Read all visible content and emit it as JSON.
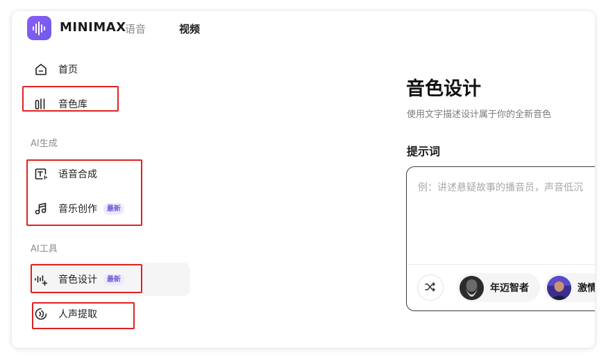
{
  "header": {
    "brand": "MINIMAX",
    "nav": [
      {
        "label": "语音"
      },
      {
        "label": "视频"
      }
    ]
  },
  "sidebar": {
    "items_top": [
      {
        "label": "首页",
        "icon": "home-icon"
      },
      {
        "label": "音色库",
        "icon": "library-icon"
      }
    ],
    "section_ai_generate": "AI生成",
    "items_generate": [
      {
        "label": "语音合成",
        "icon": "text-to-speech-icon"
      },
      {
        "label": "音乐创作",
        "icon": "music-note-icon",
        "badge": "最新"
      }
    ],
    "section_ai_tools": "AI工具",
    "items_tools": [
      {
        "label": "音色设计",
        "icon": "voice-design-icon",
        "badge": "最新",
        "active": true
      },
      {
        "label": "人声提取",
        "icon": "voice-extract-icon"
      }
    ]
  },
  "main": {
    "title": "音色设计",
    "subtitle": "使用文字描述设计属于你的全新音色",
    "prompt_label": "提示词",
    "prompt_placeholder": "例：讲述悬疑故事的播音员，声音低沉",
    "chips": [
      {
        "label": "年迈智者",
        "avatar": "elderly-sage-avatar"
      },
      {
        "label": "激情",
        "avatar": "passionate-man-avatar"
      }
    ]
  },
  "colors": {
    "accent": "#6d5ce8",
    "badge_text": "#6c63d8",
    "badge_bg": "#eeeafe",
    "highlight_box": "#e02020"
  }
}
